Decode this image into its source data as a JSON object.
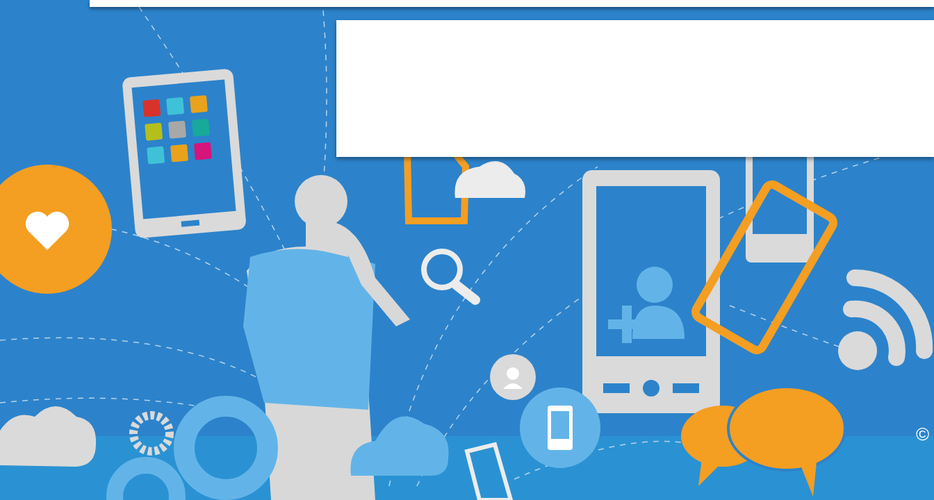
{
  "footer": {
    "copyright": "©"
  }
}
